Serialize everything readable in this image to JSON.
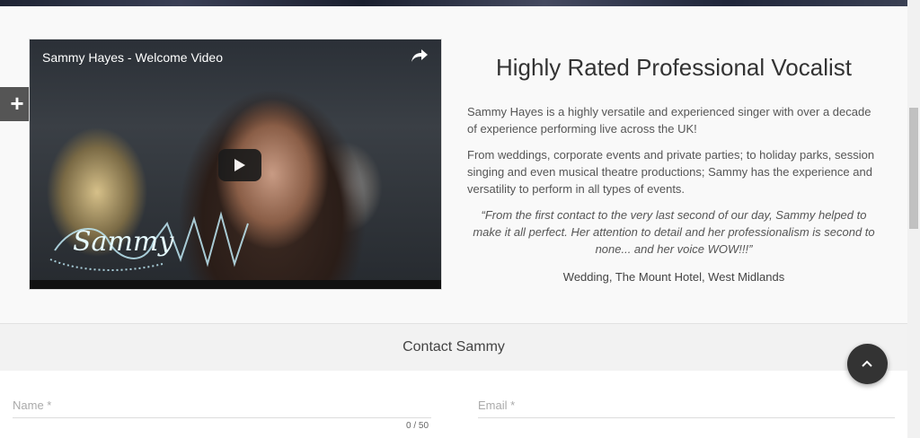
{
  "video": {
    "title": "Sammy Hayes - Welcome Video",
    "share_icon": "share-arrow-icon",
    "play_icon": "play-icon",
    "logo_text": "Sammy"
  },
  "side_button": {
    "icon": "plus-icon",
    "label": "+"
  },
  "article": {
    "heading": "Highly Rated Professional Vocalist",
    "paragraph1": "Sammy Hayes is a highly versatile and experienced singer with over a decade of experience performing live across the UK!",
    "paragraph2": "From weddings, corporate events and private parties; to holiday parks, session singing and even musical theatre productions; Sammy has the experience and versatility to perform in all types of events.",
    "quote": "“From the first contact to the very last second of our day, Sammy helped to make it all perfect. Her attention to detail and her professionalism is second to none... and her voice WOW!!!”",
    "quote_source": "Wedding, The Mount Hotel, West Midlands"
  },
  "contact": {
    "heading": "Contact Sammy",
    "name_placeholder": "Name *",
    "email_placeholder": "Email *",
    "name_counter": "0 / 50"
  },
  "scroll_top_button": {
    "icon": "chevron-up-icon"
  }
}
